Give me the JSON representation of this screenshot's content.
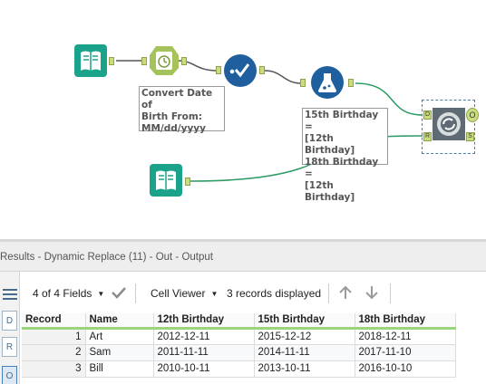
{
  "workflow": {
    "formula_annotation": "Convert Date of\nBirth From:\nMM/dd/yyyy",
    "formula2_annotation": "15th Birthday =\n[12th Birthday]\n18th Birthday =\n[12th Birthday]",
    "dynamic_replace_anchors": {
      "d": "D",
      "r": "R",
      "o": "O",
      "s": "S"
    }
  },
  "results": {
    "title": "Results - Dynamic Replace (11) - Out - Output",
    "side_buttons": [
      "D",
      "R",
      "O"
    ],
    "toolbar": {
      "fields": "4 of 4 Fields",
      "viewer": "Cell Viewer",
      "records": "3 records displayed"
    },
    "columns": [
      "Record",
      "Name",
      "12th Birthday",
      "15th Birthday",
      "18th Birthday"
    ],
    "rows": [
      [
        "1",
        "Art",
        "2012-12-11",
        "2015-12-12",
        "2018-12-11"
      ],
      [
        "2",
        "Sam",
        "2011-11-11",
        "2014-11-11",
        "2017-11-10"
      ],
      [
        "3",
        "Bill",
        "2010-10-11",
        "2013-10-11",
        "2016-10-10"
      ]
    ]
  },
  "colors": {
    "input_tool": "#1aa38a",
    "formula_tool": "#a5c35a",
    "select_tool": "#1f5f9e",
    "connection": "#2e9c64",
    "anchor": "#c9dd7e",
    "header_underline": "#9cd37f"
  }
}
